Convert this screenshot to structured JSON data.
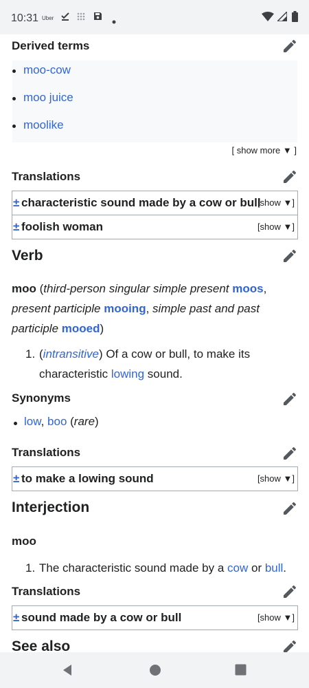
{
  "status_bar": {
    "time": "10:31",
    "app_label": "Uber"
  },
  "sections": {
    "derived_terms": {
      "heading": "Derived terms",
      "items": [
        "moo-cow",
        "moo juice",
        "moolike"
      ],
      "show_more": "[ show more ▼ ]"
    },
    "translations_1": {
      "heading": "Translations",
      "rows": [
        {
          "pm": "±",
          "text": "characteristic sound made by a cow or bull",
          "show": "[show ▼]"
        },
        {
          "pm": "±",
          "text": "foolish woman",
          "show": "[show ▼]"
        }
      ]
    },
    "verb": {
      "heading": "Verb",
      "headword": "moo",
      "forms": {
        "open": " (",
        "label1": "third-person singular simple present",
        "form1": "moos",
        "sep1": ", ",
        "label2": "present participle",
        "form2": "mooing",
        "sep2": ", ",
        "label3": "simple past and past participle",
        "form3": "mooed",
        "close": ")"
      },
      "definition": {
        "number": "1.",
        "open_paren": "(",
        "label": "intransitive",
        "close_paren": ")",
        "text_before": " Of a cow or bull, to make its characteristic ",
        "link": "lowing",
        "text_after": " sound."
      }
    },
    "synonyms": {
      "heading": "Synonyms",
      "link1": "low",
      "sep": ", ",
      "link2": "boo",
      "note_open": " (",
      "note": "rare",
      "note_close": ")"
    },
    "translations_2": {
      "heading": "Translations",
      "rows": [
        {
          "pm": "±",
          "text": "to make a lowing sound",
          "show": "[show ▼]"
        }
      ]
    },
    "interjection": {
      "heading": "Interjection",
      "headword": "moo",
      "definition": {
        "number": "1.",
        "text_before": "The characteristic sound made by a ",
        "link1": "cow",
        "mid": " or ",
        "link2": "bull",
        "end": "."
      }
    },
    "translations_3": {
      "heading": "Translations",
      "rows": [
        {
          "pm": "±",
          "text": "sound made by a cow or bull",
          "show": "[show ▼]"
        }
      ]
    },
    "see_also": {
      "heading": "See also"
    }
  },
  "icons": {
    "edit": "pencil-icon",
    "nav": [
      "back-triangle-icon",
      "home-circle-icon",
      "recents-square-icon"
    ]
  },
  "colors": {
    "link": "#3366cc",
    "text": "#202122",
    "border": "#a2a9b1",
    "bar_bg": "#f1f3f4"
  }
}
